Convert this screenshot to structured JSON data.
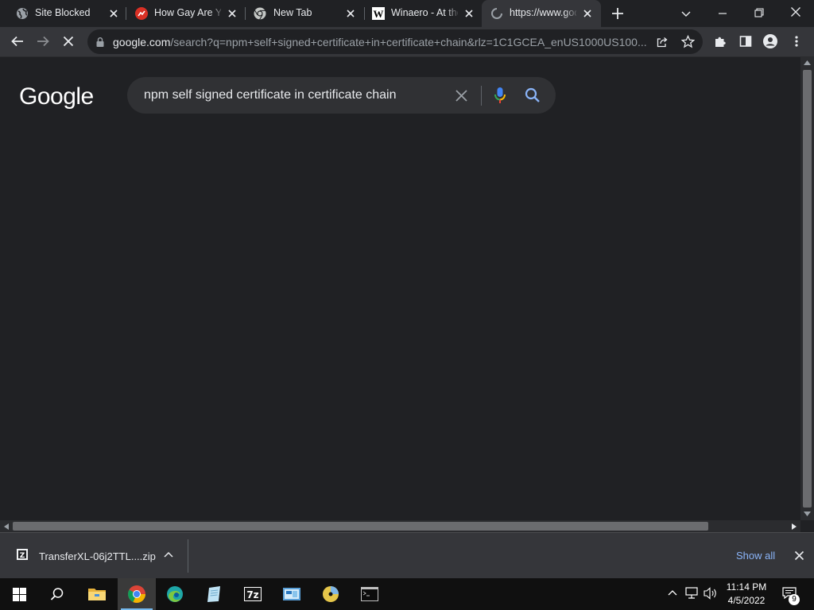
{
  "browser": {
    "tabs": [
      {
        "title": "Site Blocked",
        "favicon": "globe-icon",
        "active": false
      },
      {
        "title": "How Gay Are Yo",
        "favicon": "quiz-site-icon",
        "active": false
      },
      {
        "title": "New Tab",
        "favicon": "chrome-icon",
        "active": false
      },
      {
        "title": "Winaero - At the",
        "favicon": "winaero-w-icon",
        "active": false
      },
      {
        "title": "https://www.goo",
        "favicon": "loading-spinner-icon",
        "active": true
      }
    ],
    "new_tab_icon": "plus-icon",
    "address": {
      "host": "google.com",
      "path": "/search?q=npm+self+signed+certificate+in+certificate+chain&rlz=1C1GCEA_enUS1000US100..."
    }
  },
  "google": {
    "logo_text": "Google",
    "query": "npm self signed certificate in certificate chain"
  },
  "download": {
    "filename": "TransferXL-06j2TTL....zip",
    "show_all": "Show all"
  },
  "taskbar": {
    "time": "11:14 PM",
    "date": "4/5/2022",
    "notification_count": "9",
    "apps": [
      "start-icon",
      "search-icon",
      "file-explorer-icon",
      "chrome-icon",
      "edge-icon",
      "notepad-icon",
      "7zip-icon",
      "control-panel-icon",
      "cd-disc-icon",
      "terminal-icon"
    ]
  },
  "colors": {
    "tab_bg": "#202124",
    "toolbar_bg": "#35363a",
    "page_bg": "#202124",
    "searchbox_bg": "#303134",
    "link_blue": "#8ab4f8",
    "taskbar_bg": "#101010"
  }
}
